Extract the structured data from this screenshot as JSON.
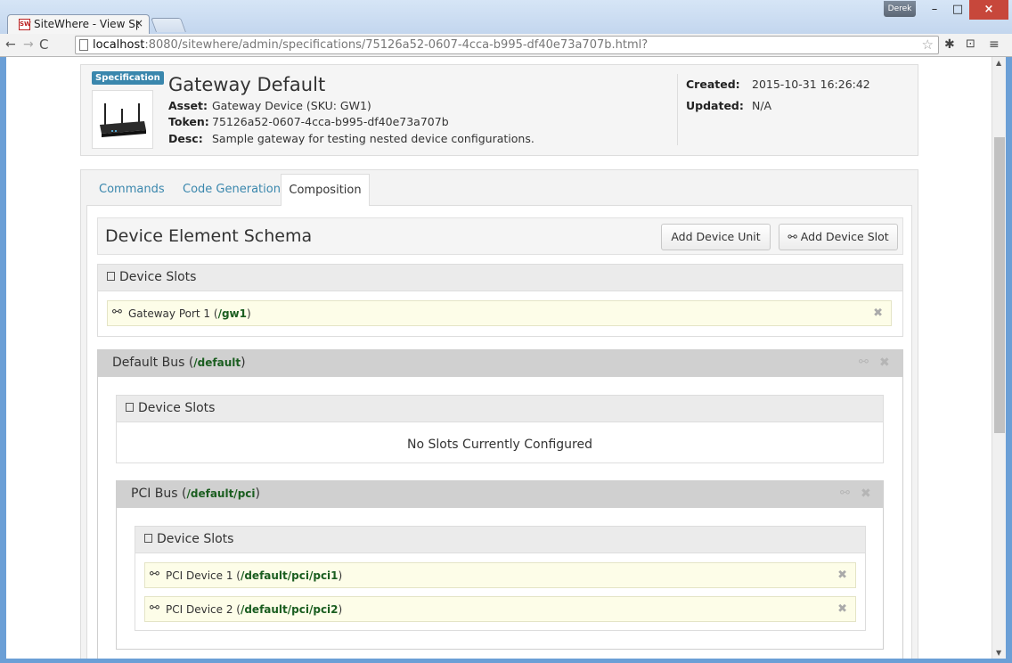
{
  "browser": {
    "tab_title": "SiteWhere - View Sp",
    "tab_close": "×",
    "favicon_text": "SW",
    "user_badge": "Derek",
    "minimize": "–",
    "maximize": "□",
    "close": "×",
    "back": "←",
    "forward": "→",
    "reload": "C",
    "url_host": "localhost",
    "url_path": ":8080/sitewhere/admin/specifications/75126a52-0607-4cca-b995-df40e73a707b.html?",
    "star": "☆",
    "gear": "✱",
    "cast": "⊡",
    "menu": "≡"
  },
  "scrollbar": {
    "up": "▲",
    "down": "▼"
  },
  "spec": {
    "badge": "Specification",
    "title": "Gateway Default",
    "asset_label": "Asset:",
    "asset_value": "Gateway Device (SKU: GW1)",
    "token_label": "Token:",
    "token_value": "75126a52-0607-4cca-b995-df40e73a707b",
    "desc_label": "Desc:",
    "desc_value": "Sample gateway for testing nested device configurations.",
    "created_label": "Created:",
    "created_value": "2015-10-31 16:26:42",
    "updated_label": "Updated:",
    "updated_value": "N/A"
  },
  "tabs": {
    "commands": "Commands",
    "codegen": "Code Generation",
    "composition": "Composition"
  },
  "schema": {
    "title": "Device Element Schema",
    "add_unit": "Add Device Unit",
    "add_slot": "Add Device Slot",
    "slots_label": "Device Slots",
    "slot1_name": "Gateway Port 1 (",
    "slot1_path": "/gw1",
    "close_paren": ")",
    "remove": "✖",
    "link": "⚯"
  },
  "default_bus": {
    "name": "Default Bus (",
    "path": "/default",
    "close_paren": ")",
    "slots_label": "Device Slots",
    "empty": "No Slots Currently Configured"
  },
  "pci_bus": {
    "name": "PCI Bus (",
    "path": "/default/pci",
    "close_paren": ")",
    "slots_label": "Device Slots",
    "slot1_name": "PCI Device 1 (",
    "slot1_path": "/default/pci/pci1",
    "slot2_name": "PCI Device 2 (",
    "slot2_path": "/default/pci/pci2"
  }
}
